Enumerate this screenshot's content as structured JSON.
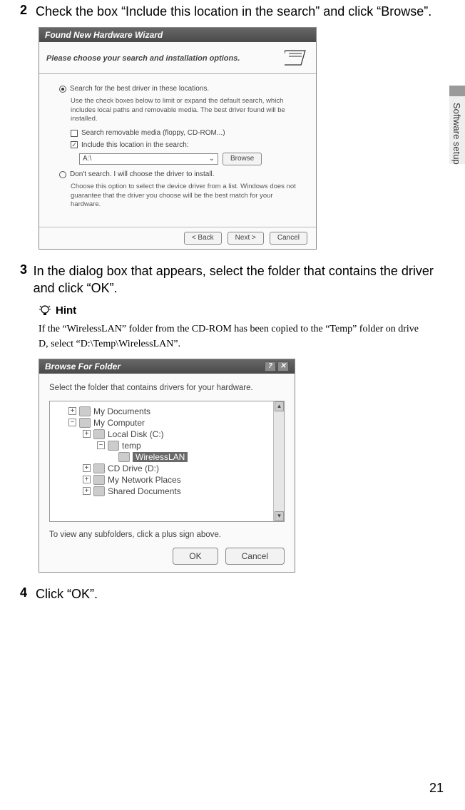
{
  "sidebar_label": "Software setup",
  "steps": {
    "s2": {
      "num": "2",
      "text": "Check the box “Include this location in the search” and click “Browse”."
    },
    "s3": {
      "num": "3",
      "text": "In the dialog box that appears, select the folder that contains the driver and click “OK”."
    },
    "s4": {
      "num": "4",
      "text": "Click “OK”."
    }
  },
  "wizard": {
    "title": "Found New Hardware Wizard",
    "subtitle": "Please choose your search and installation options.",
    "radio1": "Search for the best driver in these locations.",
    "radio1_sub": "Use the check boxes below to limit or expand the default search, which includes local paths and removable media. The best driver found will be installed.",
    "check1": "Search removable media (floppy, CD-ROM...)",
    "check2": "Include this location in the search:",
    "path": "A:\\",
    "browse": "Browse",
    "radio2": "Don't search. I will choose the driver to install.",
    "radio2_sub": "Choose this option to select the device driver from a list. Windows does not guarantee that the driver you choose will be the best match for your hardware.",
    "back": "< Back",
    "next": "Next >",
    "cancel": "Cancel"
  },
  "hint": {
    "label": "Hint",
    "text": "If the “WirelessLAN” folder from the CD-ROM has been copied to the “Temp” folder on drive D, select “D:\\Temp\\WirelessLAN”."
  },
  "browse": {
    "title": "Browse For Folder",
    "help": "?",
    "close": "✕",
    "instruction": "Select the folder that contains drivers for your hardware.",
    "nodes": {
      "mydocs": "My Documents",
      "mycomp": "My Computer",
      "localc": "Local Disk (C:)",
      "temp": "temp",
      "wlan": "WirelessLAN",
      "cddrive": "CD Drive (D:)",
      "netplaces": "My Network Places",
      "shared": "Shared Documents"
    },
    "footer": "To view any subfolders, click a plus sign above.",
    "ok": "OK",
    "cancel": "Cancel"
  },
  "page_number": "21"
}
